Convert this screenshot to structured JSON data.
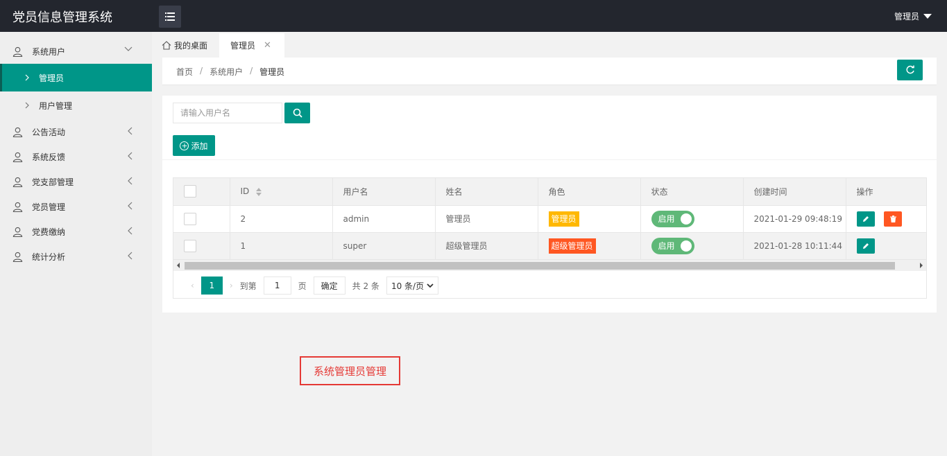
{
  "header": {
    "app_title": "党员信息管理系统",
    "user_name": "管理员"
  },
  "sidebar": {
    "groups": [
      {
        "label": "系统用户",
        "expanded": true
      },
      {
        "label": "公告活动"
      },
      {
        "label": "系统反馈"
      },
      {
        "label": "党支部管理"
      },
      {
        "label": "党员管理"
      },
      {
        "label": "党费缴纳"
      },
      {
        "label": "统计分析"
      }
    ],
    "sub_items": [
      {
        "label": "管理员",
        "active": true
      },
      {
        "label": "用户管理"
      }
    ]
  },
  "tabs": {
    "home_label": "我的桌面",
    "active_label": "管理员"
  },
  "breadcrumb": {
    "items": [
      "首页",
      "系统用户",
      "管理员"
    ]
  },
  "toolbar": {
    "search_placeholder": "请输入用户名",
    "add_label": "添加"
  },
  "table": {
    "columns": [
      "ID",
      "用户名",
      "姓名",
      "角色",
      "状态",
      "创建时间",
      "操作"
    ],
    "rows": [
      {
        "id": "2",
        "username": "admin",
        "name": "管理员",
        "role": "管理员",
        "role_color": "#ffb800",
        "status": "启用",
        "created": "2021-01-29 09:48:19"
      },
      {
        "id": "1",
        "username": "super",
        "name": "超级管理员",
        "role": "超级管理员",
        "role_color": "#ff5722",
        "status": "启用",
        "created": "2021-01-28 10:11:44"
      }
    ]
  },
  "pagination": {
    "current_page": "1",
    "goto_label": "到第",
    "goto_value": "1",
    "page_unit": "页",
    "confirm_label": "确定",
    "total_text": "共 2 条",
    "page_size": "10 条/页"
  },
  "annotation": {
    "text": "系统管理员管理"
  },
  "colors": {
    "primary": "#009688",
    "danger": "#ff5722",
    "warning": "#ffb800",
    "switch_on": "#5fb878",
    "header_bg": "#23262e"
  }
}
